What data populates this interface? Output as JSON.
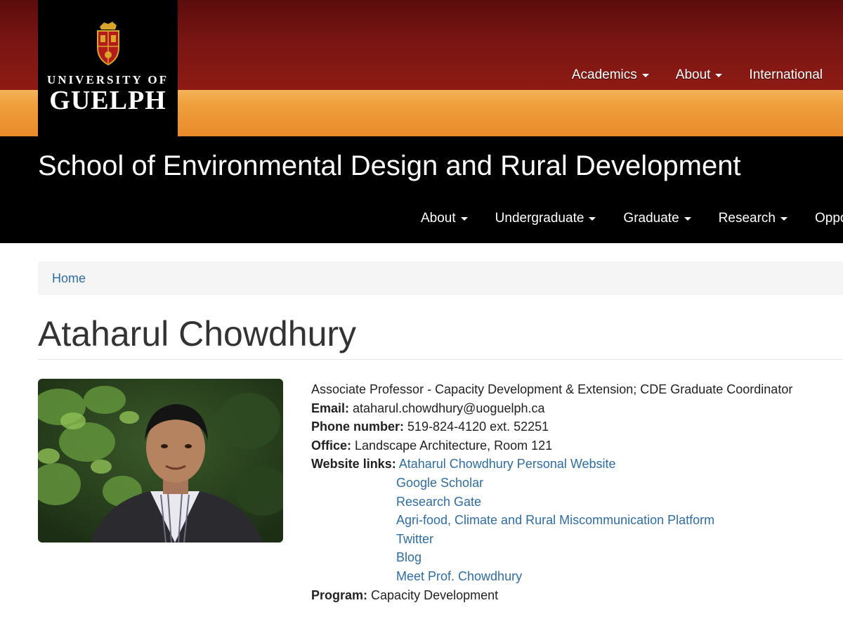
{
  "university": {
    "logo_line1": "UNIVERSITY OF",
    "logo_line2": "GUELPH",
    "nav": [
      "Academics",
      "About",
      "International"
    ]
  },
  "department": {
    "title": "School of Environmental Design and Rural Development",
    "nav": [
      "About",
      "Undergraduate",
      "Graduate",
      "Research",
      "Oppo"
    ]
  },
  "breadcrumb": {
    "home": "Home"
  },
  "profile": {
    "name": "Ataharul Chowdhury",
    "position": "Associate Professor - Capacity Development & Extension; CDE Graduate Coordinator",
    "email_label": "Email:",
    "email": "ataharul.chowdhury@uoguelph.ca",
    "phone_label": "Phone number:",
    "phone": "519-824-4120 ext. 52251",
    "office_label": "Office:",
    "office": "Landscape Architecture, Room 121",
    "links_label": "Website links:",
    "links": [
      "Ataharul Chowdhury Personal Website",
      "Google Scholar",
      "Research Gate",
      "Agri-food, Climate and Rural Miscommunication Platform",
      "Twitter",
      "Blog",
      "Meet Prof. Chowdhury"
    ],
    "program_label": "Program:",
    "program": "Capacity Development"
  },
  "colors": {
    "header_red": "#781512",
    "header_gold": "#f0a03e",
    "link_blue": "#2e6da4"
  }
}
